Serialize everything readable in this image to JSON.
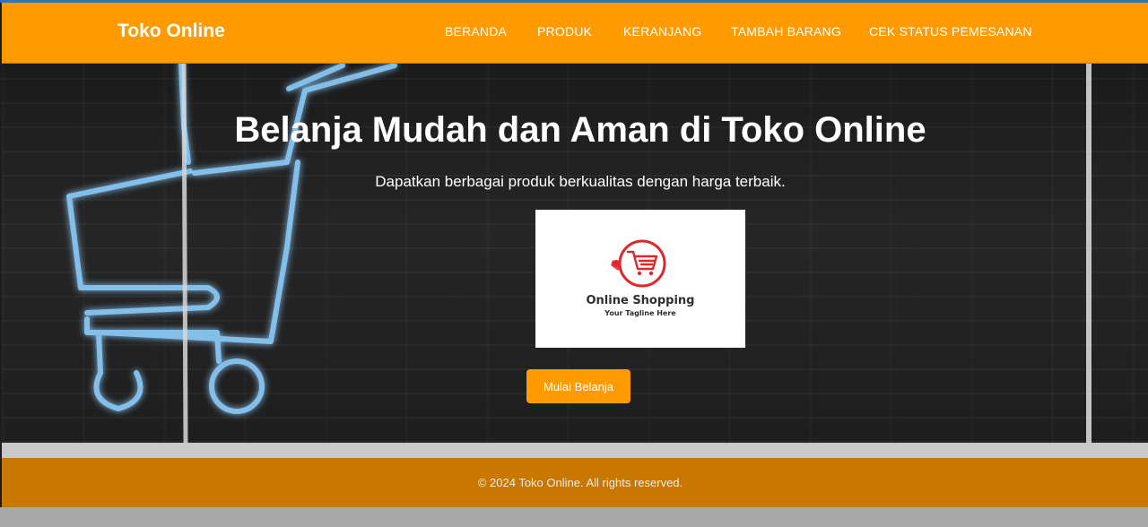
{
  "navbar": {
    "brand": "Toko Online",
    "links": [
      {
        "label": "BERANDA"
      },
      {
        "label": "PRODUK"
      },
      {
        "label": "KERANJANG"
      },
      {
        "label": "TAMBAH BARANG"
      },
      {
        "label": "CEK STATUS PEMESANAN"
      }
    ]
  },
  "hero": {
    "title": "Belanja Mudah dan Aman di Toko Online",
    "subtitle": "Dapatkan berbagai produk berkualitas dengan harga terbaik.",
    "logo": {
      "line1": "Online Shopping",
      "line2": "Your Tagline Here"
    },
    "cta_label": "Mulai Belanja"
  },
  "footer": {
    "text": "© 2024 Toko Online. All rights reserved."
  },
  "colors": {
    "accent": "#ff9a00",
    "footer": "#c87800",
    "neon": "#7ec8ff",
    "logo_red": "#e0262b"
  },
  "icons": [
    "neon-shopping-cart-icon",
    "shopping-cart-logo-icon"
  ]
}
